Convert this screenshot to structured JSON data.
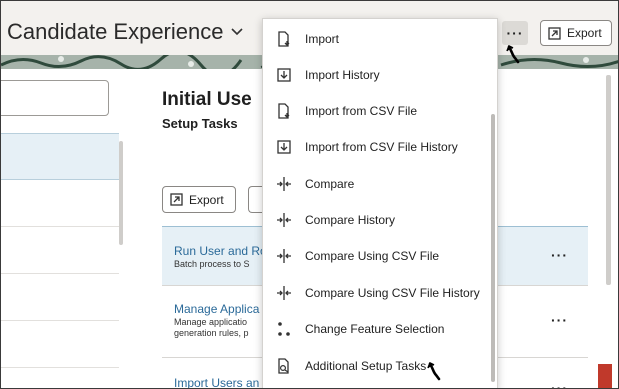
{
  "header": {
    "title": "Candidate Experience",
    "more_label": "···",
    "export_label": "Export"
  },
  "main": {
    "title": "Initial Use",
    "subtitle": "Setup Tasks",
    "export_label": "Export",
    "tasks": [
      {
        "title": "Run User and Ro",
        "desc": "Batch process to S",
        "more": "···"
      },
      {
        "title": "Manage Applica",
        "desc": "Manage applicatio generation rules, p",
        "more": "···"
      },
      {
        "title": "Import Users an",
        "desc": "",
        "more": "···"
      }
    ]
  },
  "menu": {
    "items": [
      {
        "label": "Import",
        "icon": "import-icon"
      },
      {
        "label": "Import History",
        "icon": "import-history-icon"
      },
      {
        "label": "Import from CSV File",
        "icon": "import-csv-icon"
      },
      {
        "label": "Import from CSV File History",
        "icon": "import-csv-history-icon"
      },
      {
        "label": "Compare",
        "icon": "compare-icon"
      },
      {
        "label": "Compare History",
        "icon": "compare-icon"
      },
      {
        "label": "Compare Using CSV File",
        "icon": "compare-icon"
      },
      {
        "label": "Compare Using CSV File History",
        "icon": "compare-icon"
      },
      {
        "label": "Change Feature Selection",
        "icon": "feature-selection-icon"
      },
      {
        "label": "Additional Setup Tasks",
        "icon": "setup-tasks-icon"
      }
    ]
  },
  "colors": {
    "link": "#2b6a99",
    "selected_row": "#e6f0f6",
    "header_bg": "#f3f1ee",
    "badge": "#c0392b"
  }
}
